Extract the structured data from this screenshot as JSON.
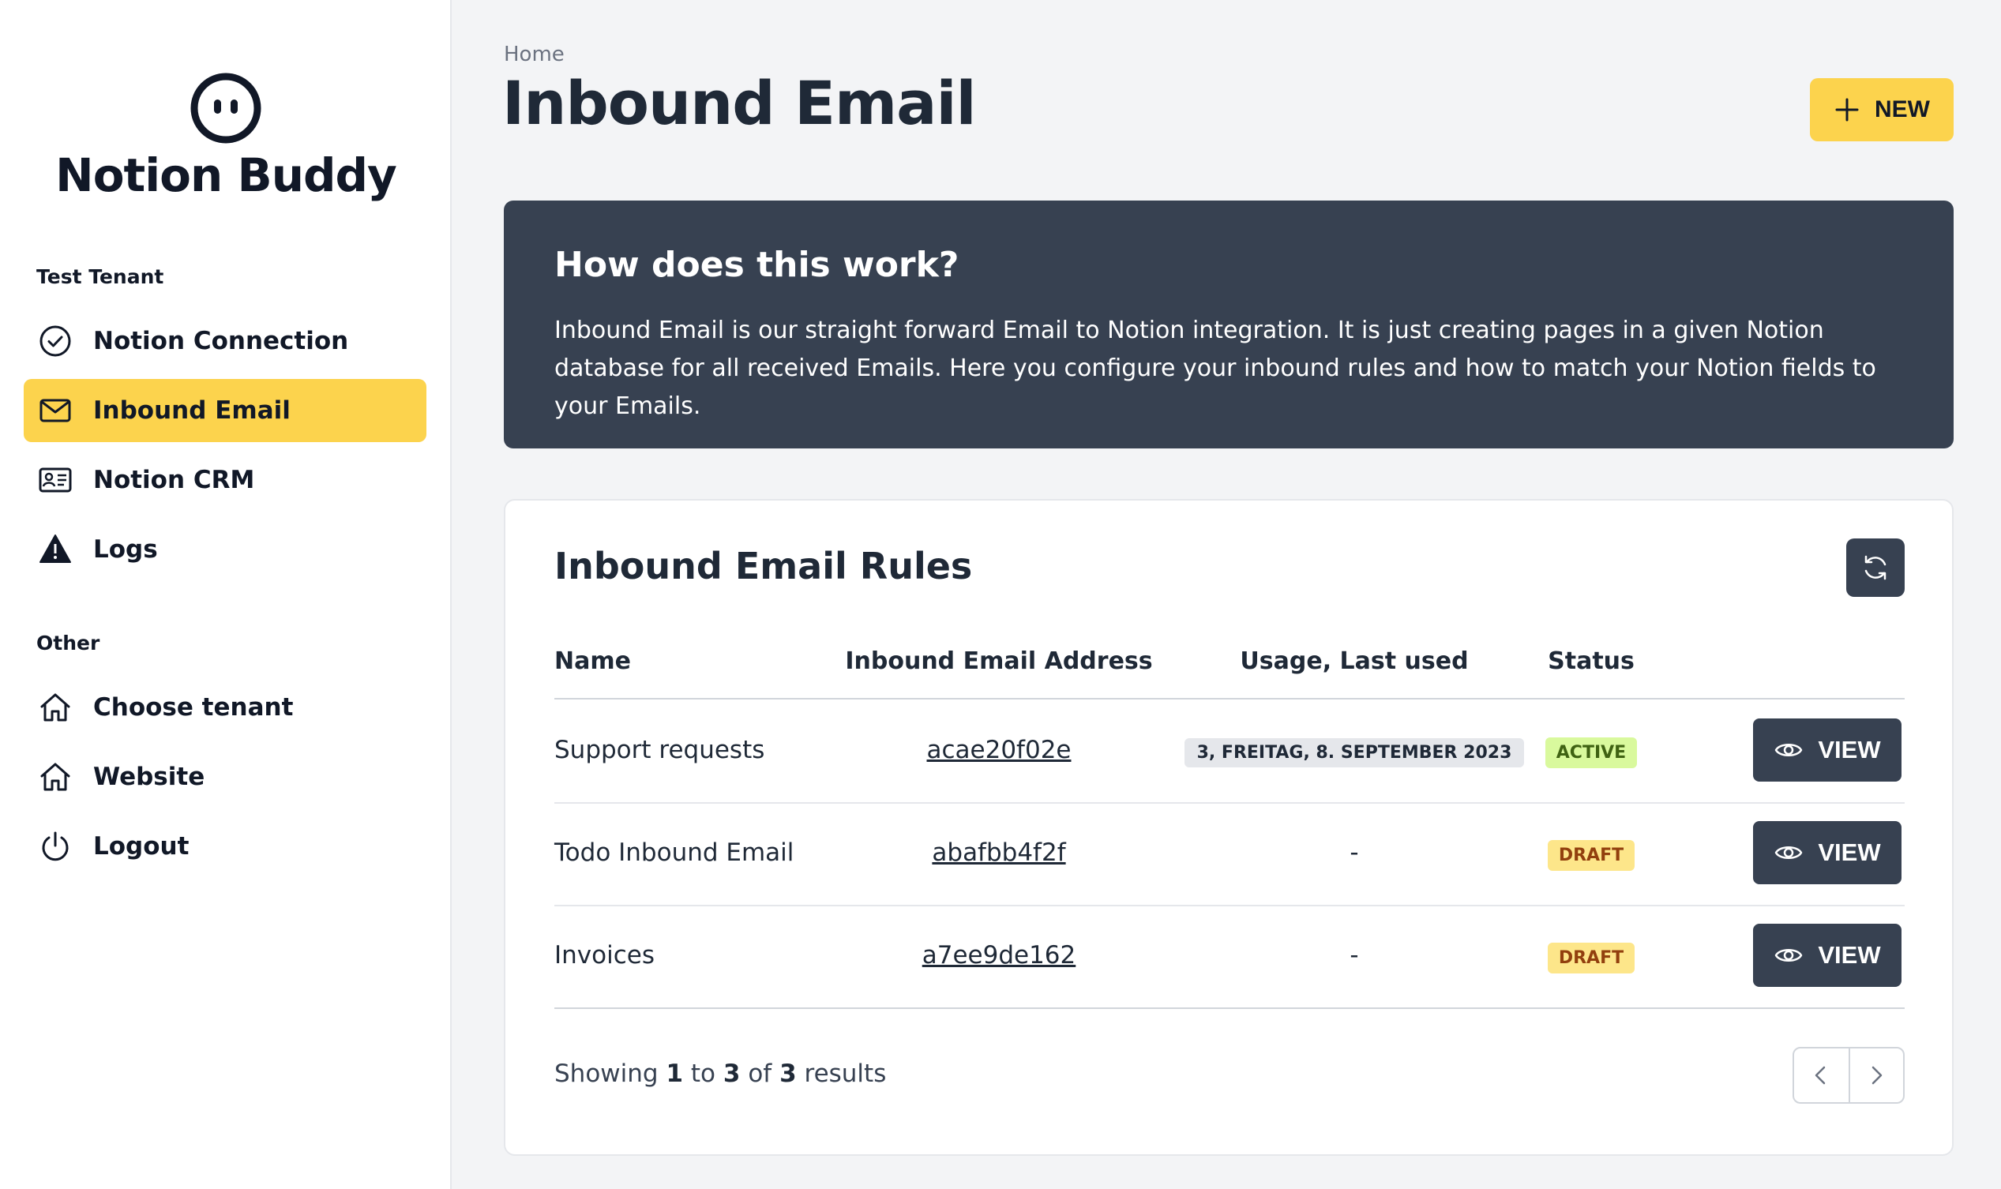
{
  "app": {
    "name": "Notion Buddy"
  },
  "sidebar": {
    "section1_label": "Test Tenant",
    "section2_label": "Other",
    "items": [
      {
        "label": "Notion Connection",
        "icon": "check-circle-icon",
        "active": false
      },
      {
        "label": "Inbound Email",
        "icon": "mail-icon",
        "active": true
      },
      {
        "label": "Notion CRM",
        "icon": "id-card-icon",
        "active": false
      },
      {
        "label": "Logs",
        "icon": "warning-icon",
        "active": false
      },
      {
        "label": "Choose tenant",
        "icon": "home-icon",
        "active": false
      },
      {
        "label": "Website",
        "icon": "home-icon",
        "active": false
      },
      {
        "label": "Logout",
        "icon": "power-icon",
        "active": false
      }
    ]
  },
  "header": {
    "breadcrumb": "Home",
    "title": "Inbound Email",
    "new_label": "NEW"
  },
  "info": {
    "title": "How does this work?",
    "text": "Inbound Email is our straight forward Email to Notion integration. It is just creating pages in a given Notion database for all received Emails. Here you configure your inbound rules and how to match your Notion fields to your Emails."
  },
  "rules": {
    "title": "Inbound Email Rules",
    "columns": [
      "Name",
      "Inbound Email Address",
      "Usage, Last used",
      "Status"
    ],
    "rows": [
      {
        "name": "Support requests",
        "address": "acae20f02e",
        "usage": "3, FREITAG, 8. SEPTEMBER 2023",
        "status": "ACTIVE",
        "action": "VIEW"
      },
      {
        "name": "Todo Inbound Email",
        "address": "abafbb4f2f",
        "usage": "-",
        "status": "DRAFT",
        "action": "VIEW"
      },
      {
        "name": "Invoices",
        "address": "a7ee9de162",
        "usage": "-",
        "status": "DRAFT",
        "action": "VIEW"
      }
    ],
    "footer": {
      "showing": "Showing",
      "from": "1",
      "to_word": "to",
      "to": "3",
      "of_word": "of",
      "total": "3",
      "results_word": "results"
    }
  },
  "colors": {
    "accent": "#fcd34d",
    "dark": "#374151",
    "active_badge": "#d9f99d",
    "draft_badge": "#fde68a"
  }
}
